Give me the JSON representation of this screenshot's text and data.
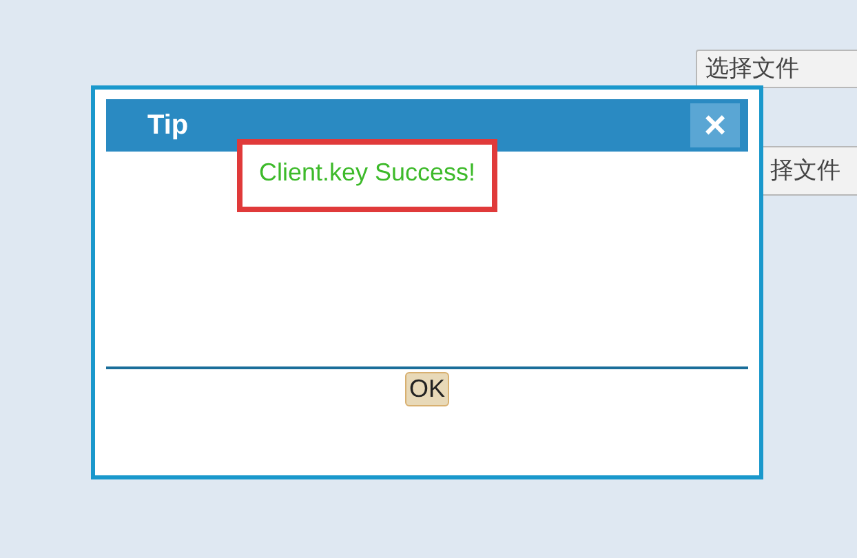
{
  "page_buttons": [
    {
      "label": "选择文件"
    },
    {
      "label": "择文件"
    }
  ],
  "dialog": {
    "title": "Tip",
    "close": "×",
    "message": "Client.key Success!",
    "buttons": [
      "OK"
    ]
  }
}
